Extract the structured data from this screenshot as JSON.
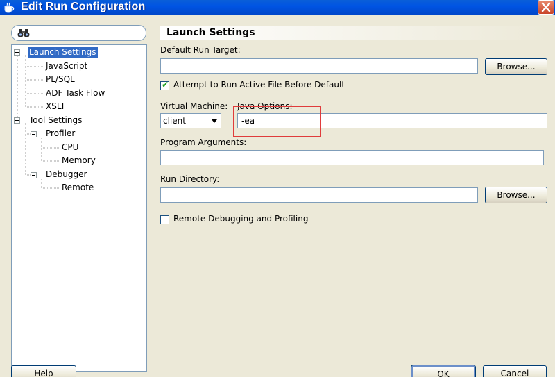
{
  "window": {
    "title": "Edit Run Configuration"
  },
  "search": {
    "value": ""
  },
  "tree": {
    "items": [
      {
        "label": "Launch Settings",
        "selected": true
      },
      {
        "label": "JavaScript"
      },
      {
        "label": "PL/SQL"
      },
      {
        "label": "ADF Task Flow"
      },
      {
        "label": "XSLT"
      },
      {
        "label": "Tool Settings"
      },
      {
        "label": "Profiler"
      },
      {
        "label": "CPU"
      },
      {
        "label": "Memory"
      },
      {
        "label": "Debugger"
      },
      {
        "label": "Remote"
      }
    ]
  },
  "panel": {
    "heading": "Launch Settings",
    "default_run_target_label": "Default Run Target:",
    "default_run_target_value": "",
    "browse_label": "Browse...",
    "attempt_label": "Attempt to Run Active File Before Default",
    "attempt_checked": true,
    "virtual_machine_label": "Virtual Machine:",
    "virtual_machine_value": "client",
    "java_options_label": "Java Options:",
    "java_options_value": "-ea",
    "program_arguments_label": "Program Arguments:",
    "program_arguments_value": "",
    "run_directory_label": "Run Directory:",
    "run_directory_value": "",
    "browse2_label": "Browse...",
    "remote_debug_label": "Remote Debugging and Profiling",
    "remote_debug_checked": false
  },
  "footer": {
    "help_label": "Help",
    "ok_label": "OK",
    "cancel_label": "Cancel"
  },
  "colors": {
    "title_bar": "#0054e3",
    "selection": "#316ac5",
    "annotation_box": "#e03c3c"
  }
}
